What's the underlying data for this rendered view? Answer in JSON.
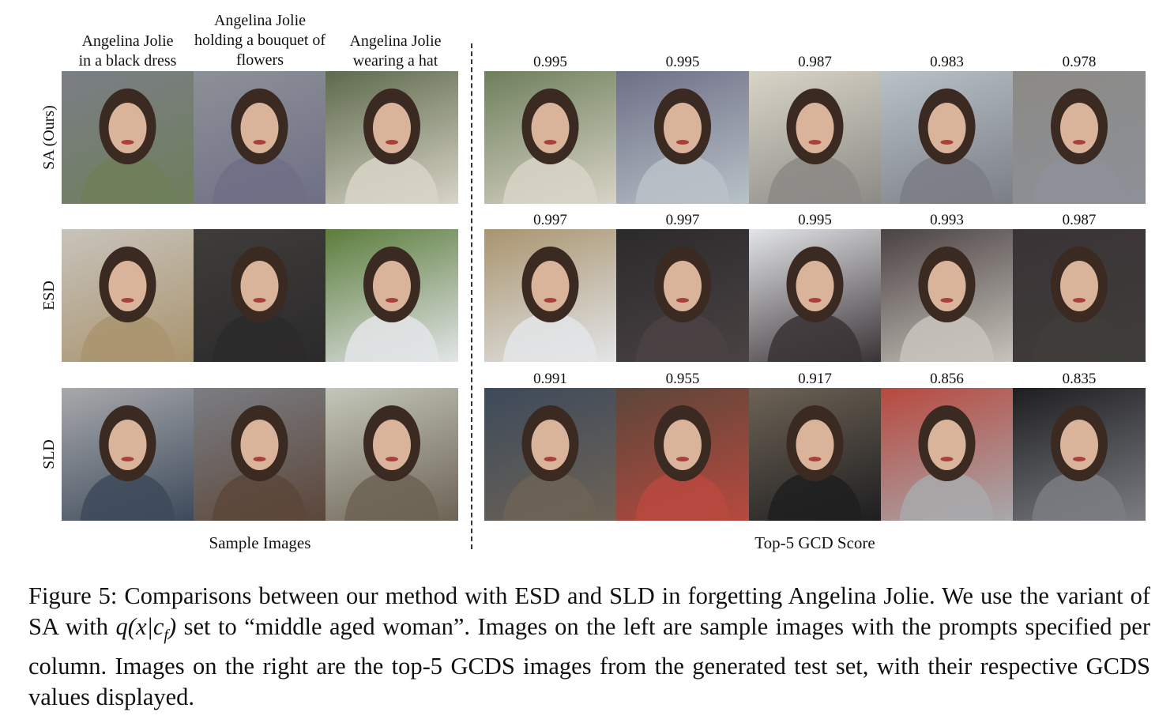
{
  "columns": [
    "Angelina Jolie\nin a black dress",
    "Angelina Jolie\nholding a bouquet of\nflowers",
    "Angelina Jolie\nwearing a hat"
  ],
  "rows": [
    {
      "label": "SA (Ours)",
      "scores": [
        "0.995",
        "0.995",
        "0.987",
        "0.983",
        "0.978"
      ]
    },
    {
      "label": "ESD",
      "scores": [
        "0.997",
        "0.997",
        "0.995",
        "0.993",
        "0.987"
      ]
    },
    {
      "label": "SLD",
      "scores": [
        "0.991",
        "0.955",
        "0.917",
        "0.856",
        "0.835"
      ]
    }
  ],
  "left_title": "Sample Images",
  "right_title": "Top-5 GCD Score",
  "caption": {
    "part1": "Figure 5: Comparisons between our method with ESD and SLD in forgetting Angelina Jolie. We use the variant of SA with ",
    "math": "q(x|c",
    "math_sub": "f",
    "math_end": ")",
    "part2": " set to “middle aged woman”. Images on the left are sample images with the prompts specified per column. Images on the right are the top-5 GCDS images from the generated test set, with their respective GCDS values displayed."
  },
  "colors": {
    "sa_bg": [
      "#7b7e85",
      "#8d9097",
      "#5d6a4c",
      "#6e7f5b",
      "#6e6f86",
      "#d8d4c7",
      "#b8c2c8",
      "#8c8a86"
    ],
    "esd_bg": [
      "#c8c3bb",
      "#3f3d3a",
      "#5b7d3c",
      "#a9946e",
      "#2b2a2b",
      "#e3e5e8",
      "#4a4243",
      "#3a3336"
    ],
    "sld_bg": [
      "#a8a9ac",
      "#7b7d83",
      "#c3c7b9",
      "#3d4a5b",
      "#5c4639",
      "#6d6355",
      "#b8493f",
      "#1e1e20"
    ]
  }
}
